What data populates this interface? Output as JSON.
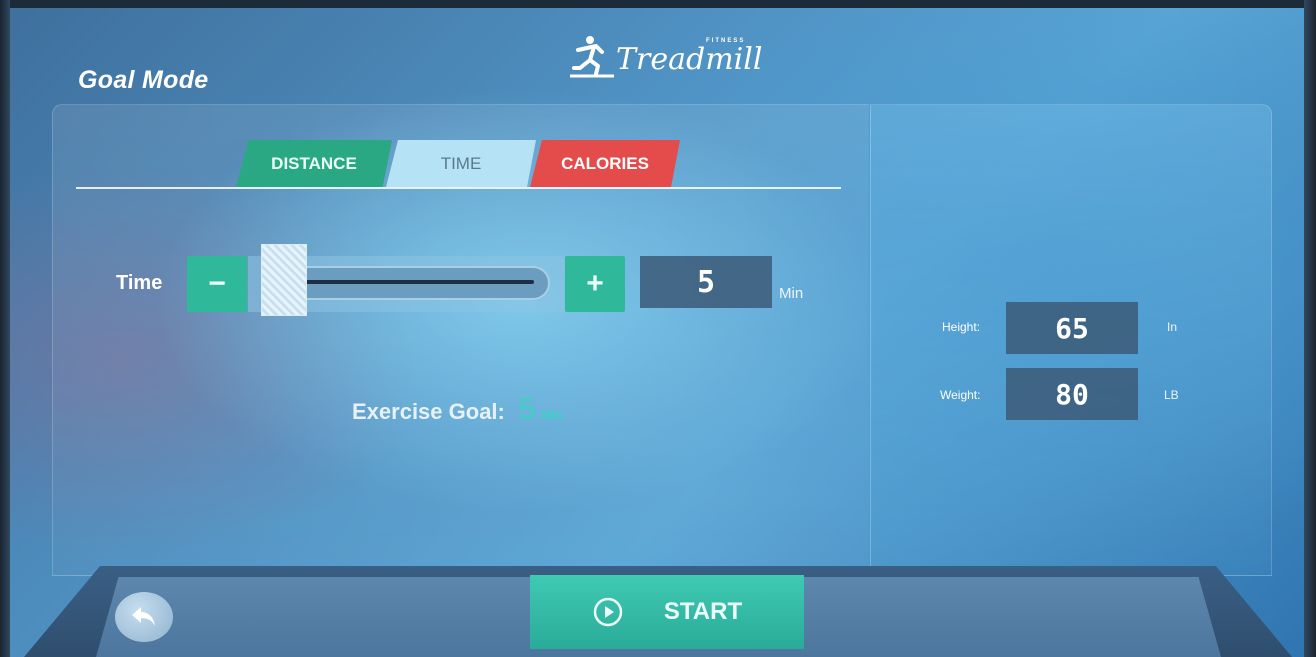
{
  "header": {
    "mode_title": "Goal Mode",
    "logo_text": "Treadmill",
    "logo_small": "FITNESS"
  },
  "tabs": [
    {
      "label": "DISTANCE",
      "color": "#2aa884"
    },
    {
      "label": "TIME",
      "color": "#b5e3f5",
      "active": true
    },
    {
      "label": "CALORIES",
      "color": "#e44c4c"
    }
  ],
  "time_control": {
    "label": "Time",
    "minus_label": "−",
    "plus_label": "+",
    "value": "5",
    "unit": "Min",
    "slider_level": 0.0
  },
  "goal": {
    "label": "Exercise Goal:",
    "value": "5",
    "unit": "Min"
  },
  "profile": {
    "height_label": "Height:",
    "height_value": "65",
    "height_unit": "In",
    "weight_label": "Weight:",
    "weight_value": "80",
    "weight_unit": "LB"
  },
  "footer": {
    "start_label": "START"
  },
  "icons": {
    "back": "back-arrow-icon",
    "start": "play-circle-icon",
    "logo": "runner-icon"
  },
  "colors": {
    "accent_green": "#2fb89a",
    "goal_value": "#3cd1c3",
    "calories_red": "#e44c4c"
  }
}
